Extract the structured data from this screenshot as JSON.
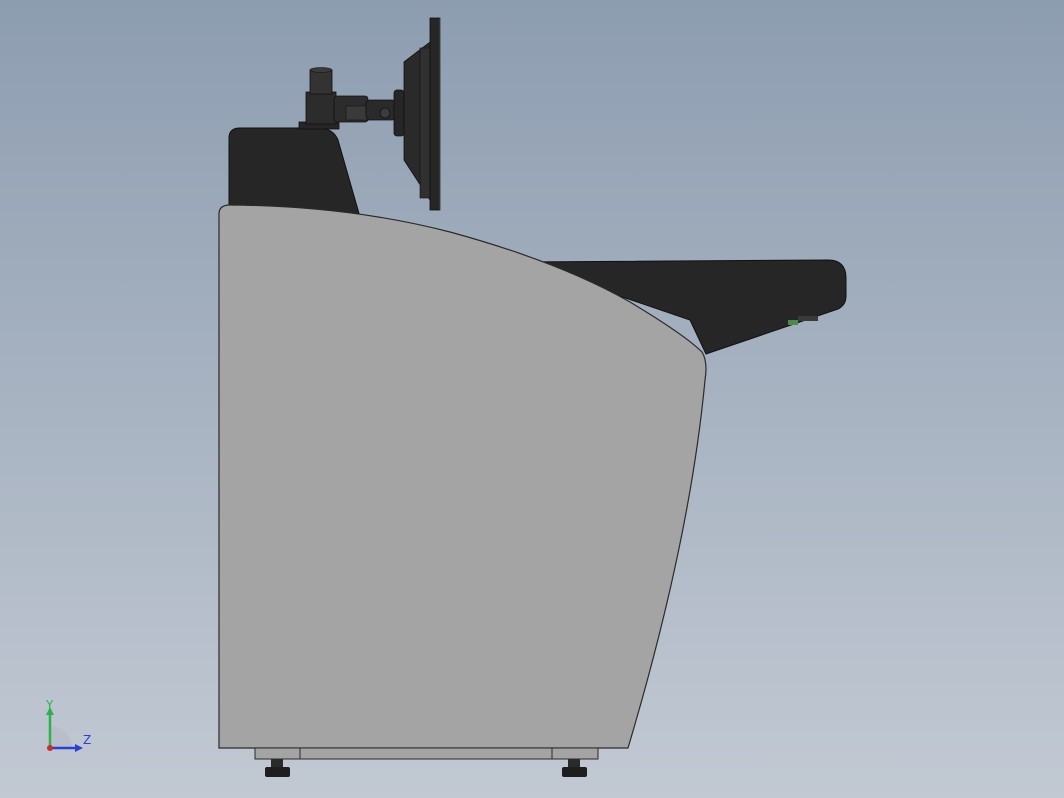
{
  "view": {
    "background_top": "#8d9db0",
    "background_bottom": "#c2c9d3",
    "body_color": "#a4a4a4",
    "dark_color": "#262626"
  },
  "triad": {
    "y_label": "Y",
    "z_label": "Z",
    "y_color": "#2bb24c",
    "z_color": "#2b3fd6",
    "x_color": "#d12b2b"
  }
}
